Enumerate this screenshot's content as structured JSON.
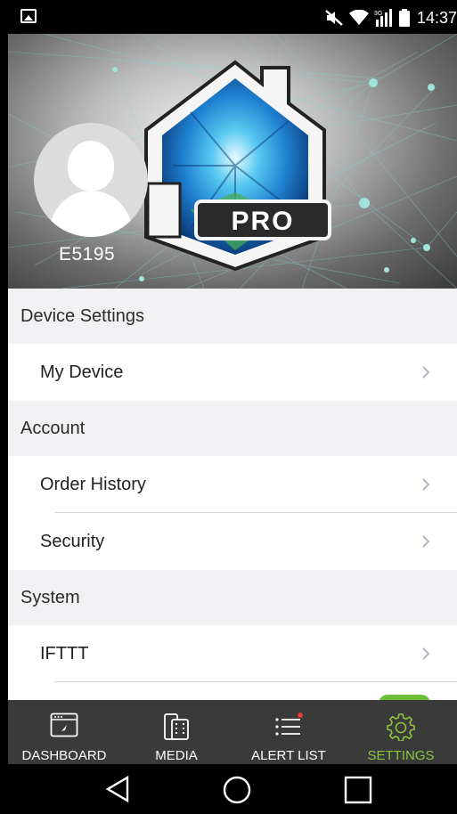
{
  "status_bar": {
    "time": "14:37",
    "network": "3G"
  },
  "profile": {
    "username": "E5195",
    "logo_text": "PRO"
  },
  "sections": [
    {
      "title": "Device Settings",
      "items": [
        {
          "label": "My Device"
        }
      ]
    },
    {
      "title": "Account",
      "items": [
        {
          "label": "Order History"
        },
        {
          "label": "Security"
        }
      ]
    },
    {
      "title": "System",
      "items": [
        {
          "label": "IFTTT"
        }
      ]
    }
  ],
  "bottom_nav": {
    "items": [
      {
        "label": "DASHBOARD",
        "icon": "dashboard-icon"
      },
      {
        "label": "MEDIA",
        "icon": "media-icon"
      },
      {
        "label": "ALERT LIST",
        "icon": "alert-list-icon"
      },
      {
        "label": "SETTINGS",
        "icon": "gear-icon"
      }
    ],
    "active": "SETTINGS",
    "active_color": "#8bc53f"
  },
  "colors": {
    "section_bg": "#f1f1f3",
    "nav_bg": "#3a3a3a",
    "toggle": "#6fbf3a"
  }
}
